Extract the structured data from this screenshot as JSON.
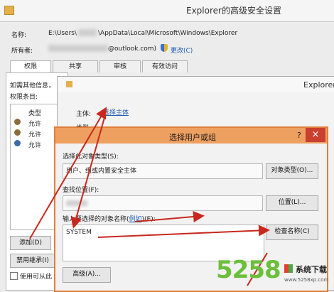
{
  "outer_window": {
    "title": "Explorer的高级安全设置",
    "name_label": "名称:",
    "name_value_prefix": "E:\\Users\\",
    "name_value_suffix": "\\AppData\\Local\\Microsoft\\Windows\\Explorer",
    "owner_label": "所有者:",
    "owner_value": "@outlook.com)",
    "change_link": "更改(C)",
    "tabs": [
      "权限",
      "共享",
      "审核",
      "有效访问"
    ],
    "info_text": "如需其他信息，",
    "perm_entries_label": "权限条目:",
    "type_col": "类型",
    "entries": [
      "允许",
      "允许",
      "允许"
    ],
    "add_button": "添加(D)",
    "disable_inherit_button": "禁用继承(I)",
    "use_inherit_checkbox": "使用可从此"
  },
  "middle_window": {
    "title": "Explorer",
    "principal_label": "主体:",
    "select_principal_link": "选择主体",
    "type_label": "类型:"
  },
  "dialog": {
    "title": "选择用户或组",
    "object_type_label": "选择此对象类型(S):",
    "object_type_value": "用户、组或内置安全主体",
    "object_type_button": "对象类型(O)...",
    "location_label": "查找位置(F):",
    "location_button": "位置(L)...",
    "enter_names_label_a": "输入要选择的对象名称(",
    "enter_names_link": "例如",
    "enter_names_label_b": ")(E):",
    "names_value": "SYSTEM",
    "check_names_button": "检查名称(C)",
    "advanced_button": "高级(A)...",
    "help_button": "?",
    "close_button": "×"
  },
  "watermark": {
    "number": "5258",
    "site": "系统下载",
    "domain": "www.5258xp.com"
  },
  "colors": {
    "arrow": "#c8281e",
    "dialog_border": "#e07f3a",
    "dialog_close": "#c9402f",
    "link": "#1f5fb5",
    "watermark_green": "#6bbf3a"
  }
}
